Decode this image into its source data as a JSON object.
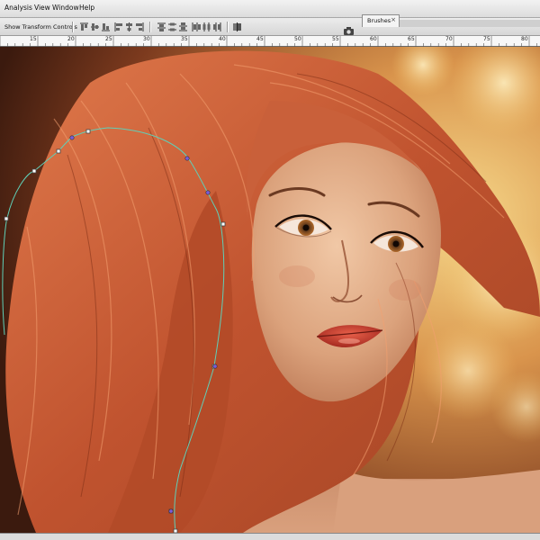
{
  "menubar": {
    "items": [
      "Analysis",
      "View",
      "Window",
      "Help"
    ]
  },
  "options_bar": {
    "show_transform_controls": "Show Transform Controls",
    "show_transform_checked": true
  },
  "panels": {
    "brushes_tab": "Brushes",
    "close_glyph": "×"
  },
  "ruler": {
    "labels": [
      "15",
      "20",
      "25",
      "30",
      "35",
      "40",
      "45",
      "50",
      "55",
      "60",
      "65",
      "70",
      "75",
      "80"
    ]
  },
  "canvas": {
    "content": "digital painting portrait",
    "path_selected": true
  },
  "colors": {
    "chrome": "#dcdcdc",
    "path_stroke": "#5fd0b8",
    "hair": "#c8603a",
    "bokeh": "#f2c46a"
  },
  "icons": [
    "align-icon",
    "distribute-icon",
    "auto-align-icon",
    "camera-icon",
    "close-icon",
    "checkbox-icon"
  ]
}
